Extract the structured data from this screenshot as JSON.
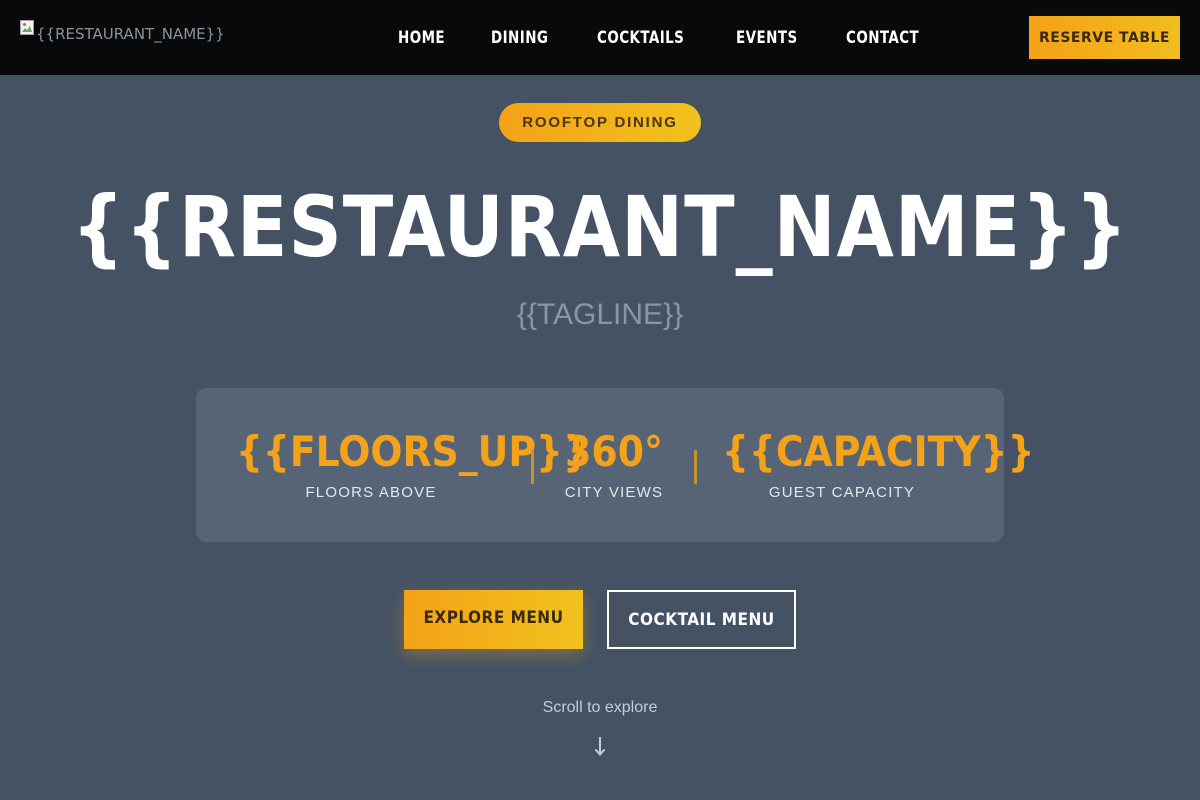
{
  "header": {
    "logo_alt": "{{RESTAURANT_NAME}}",
    "logo_icon": "broken-image-icon",
    "nav": [
      {
        "label": "HOME"
      },
      {
        "label": "DINING"
      },
      {
        "label": "COCKTAILS"
      },
      {
        "label": "EVENTS"
      },
      {
        "label": "CONTACT"
      }
    ],
    "reserve_label": "RESERVE TABLE"
  },
  "hero": {
    "badge": "ROOFTOP DINING",
    "title": "{{RESTAURANT_NAME}}",
    "tagline": "{{TAGLINE}}"
  },
  "stats": [
    {
      "value": "{{FLOORS_UP}}",
      "label": "FLOORS ABOVE"
    },
    {
      "value": "360°",
      "label": "CITY VIEWS"
    },
    {
      "value": "{{CAPACITY}}",
      "label": "GUEST CAPACITY"
    }
  ],
  "cta": {
    "primary_label": "EXPLORE MENU",
    "secondary_label": "COCKTAIL MENU"
  },
  "scroll": {
    "label": "Scroll to explore",
    "icon": "arrow-down-icon"
  },
  "colors": {
    "accent": "#f4a217",
    "background": "#445264",
    "header_bg": "#08090b",
    "stats_bg": "#566476"
  }
}
